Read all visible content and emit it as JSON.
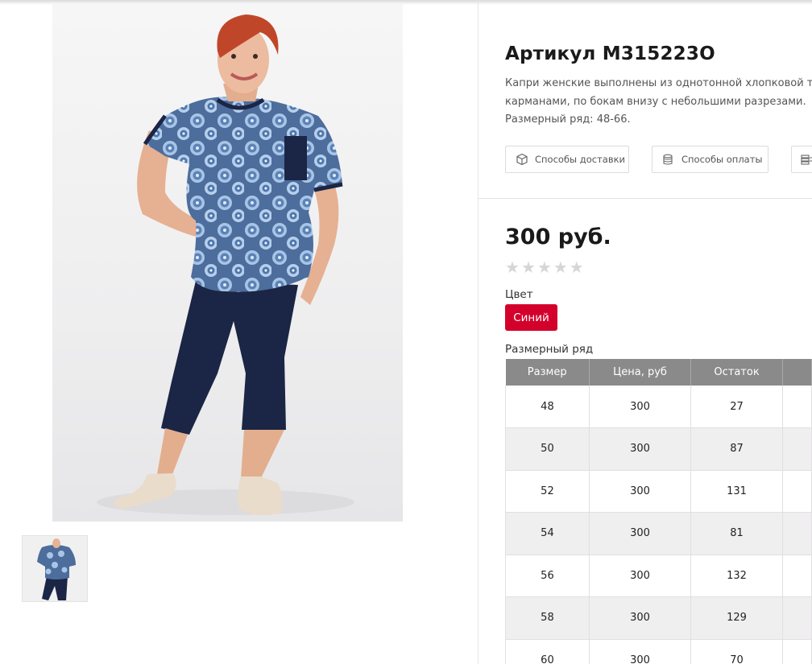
{
  "product": {
    "title": "Артикул М315223О",
    "description_lines": [
      "Капри женские выполнены из однотонной хлопковой ткани",
      "карманами, по бокам внизу с небольшими разрезами.",
      "Размерный ряд: 48-66."
    ],
    "price": "300 руб.",
    "rating": {
      "stars_total": 5,
      "stars_filled": 0,
      "star_glyph": "★"
    }
  },
  "info_buttons": {
    "delivery": {
      "label": "Способы доставки",
      "icon": "box-icon"
    },
    "payment": {
      "label": "Способы оплаты",
      "icon": "coins-icon"
    },
    "third": {
      "label": "",
      "icon": "stack-icon"
    }
  },
  "color_section": {
    "label": "Цвет",
    "selected": "Синий",
    "accent": "#d3002b"
  },
  "size_section": {
    "label": "Размерный ряд",
    "columns": [
      "Размер",
      "Цена, руб",
      "Остаток",
      ""
    ],
    "rows": [
      [
        "48",
        "300",
        "27",
        ""
      ],
      [
        "50",
        "300",
        "87",
        ""
      ],
      [
        "52",
        "300",
        "131",
        ""
      ],
      [
        "54",
        "300",
        "81",
        ""
      ],
      [
        "56",
        "300",
        "132",
        ""
      ],
      [
        "58",
        "300",
        "129",
        ""
      ],
      [
        "60",
        "300",
        "70",
        ""
      ]
    ]
  },
  "gallery": {
    "thumbnails": 1,
    "colors": {
      "top": "#4e6f9e",
      "pants": "#1b2545",
      "shoes": "#e9dccb",
      "skin": "#e8b394",
      "hair": "#c0462a"
    }
  }
}
